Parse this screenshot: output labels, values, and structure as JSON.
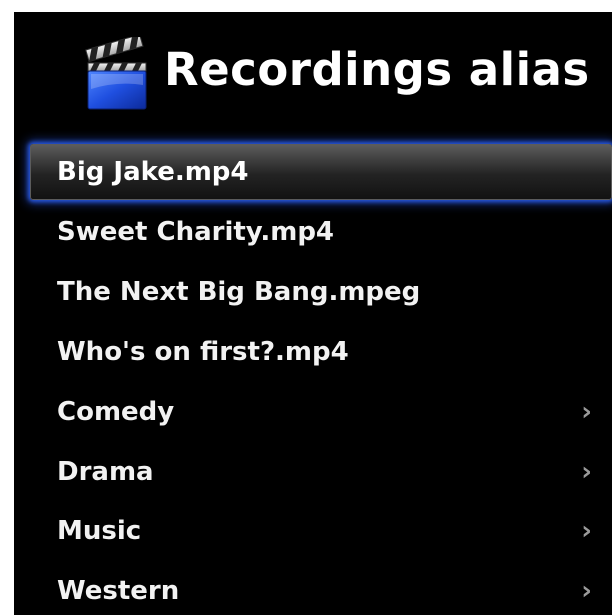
{
  "header": {
    "title": "Recordings alias",
    "icon": "clapperboard-icon"
  },
  "menu": {
    "items": [
      {
        "label": "Big Jake.mp4",
        "selected": true,
        "has_submenu": false
      },
      {
        "label": "Sweet Charity.mp4",
        "selected": false,
        "has_submenu": false
      },
      {
        "label": "The Next Big Bang.mpeg",
        "selected": false,
        "has_submenu": false
      },
      {
        "label": "Who's on first?.mp4",
        "selected": false,
        "has_submenu": false
      },
      {
        "label": "Comedy",
        "selected": false,
        "has_submenu": true
      },
      {
        "label": "Drama",
        "selected": false,
        "has_submenu": true
      },
      {
        "label": "Music",
        "selected": false,
        "has_submenu": true
      },
      {
        "label": "Western",
        "selected": false,
        "has_submenu": true
      }
    ],
    "chevron_glyph": "›"
  },
  "colors": {
    "background": "#000000",
    "text": "#ffffff",
    "selection_glow": "#2a5ae6",
    "chevron": "#9a9a9a",
    "clapper_blue": "#1f4fe0"
  }
}
